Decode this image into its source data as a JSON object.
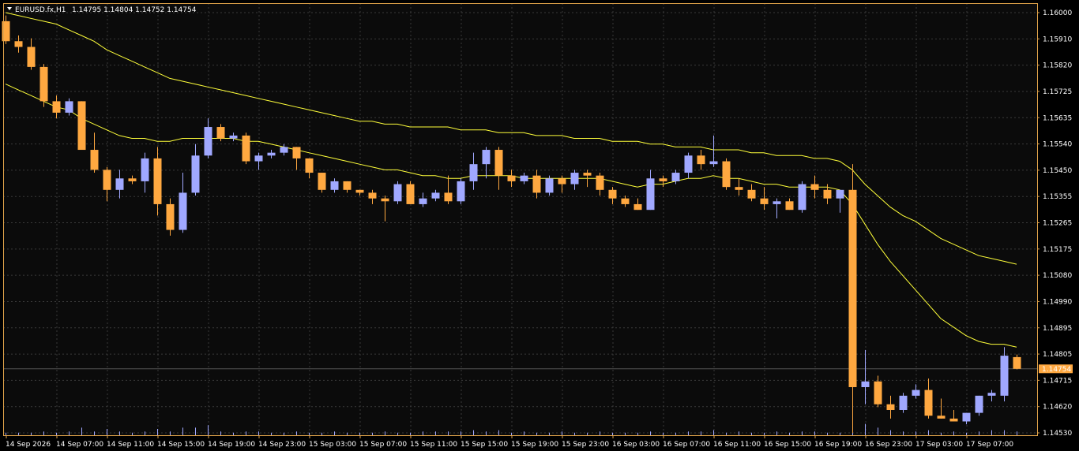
{
  "header": {
    "symbol_label": "EURUSD.fx,H1",
    "ohlc_text": "1.14795 1.14804 1.14752 1.14754"
  },
  "colors": {
    "background": "#000000",
    "plot_background": "#0b0b0b",
    "frame": "#e0a34a",
    "grid": "#3a3a3a",
    "bull": "#a0a8ff",
    "bear": "#ffa840",
    "ma": "#ffff3a",
    "text": "#ffffff",
    "price_tag_bg": "#ffa840",
    "volume": "#a0a8ff"
  },
  "chart_data": {
    "type": "candlestick",
    "symbol": "EURUSD.fx",
    "timeframe": "H1",
    "y_ticks": [
      "1.16000",
      "1.15910",
      "1.15820",
      "1.15725",
      "1.15635",
      "1.15540",
      "1.15450",
      "1.15355",
      "1.15265",
      "1.15175",
      "1.15080",
      "1.14990",
      "1.14895",
      "1.14805",
      "1.14715",
      "1.14620",
      "1.14530"
    ],
    "ylim": [
      1.1453,
      1.1605
    ],
    "current_price": 1.14754,
    "current_price_label": "1.14754",
    "x_ticks": [
      "14 Sep 2026",
      "14 Sep 07:00",
      "14 Sep 11:00",
      "14 Sep 15:00",
      "14 Sep 19:00",
      "14 Sep 23:00",
      "15 Sep 03:00",
      "15 Sep 07:00",
      "15 Sep 11:00",
      "15 Sep 15:00",
      "15 Sep 19:00",
      "15 Sep 23:00",
      "16 Sep 03:00",
      "16 Sep 07:00",
      "16 Sep 11:00",
      "16 Sep 15:00",
      "16 Sep 19:00",
      "16 Sep 23:00",
      "17 Sep 03:00",
      "17 Sep 07:00"
    ],
    "candles": [
      [
        1.1597,
        1.1599,
        1.1589,
        1.159
      ],
      [
        1.159,
        1.1592,
        1.1586,
        1.1588
      ],
      [
        1.1588,
        1.1591,
        1.158,
        1.1581
      ],
      [
        1.1581,
        1.1582,
        1.1567,
        1.1569
      ],
      [
        1.1569,
        1.1571,
        1.1563,
        1.1565
      ],
      [
        1.1565,
        1.157,
        1.1564,
        1.1569
      ],
      [
        1.1569,
        1.1569,
        1.1552,
        1.1552
      ],
      [
        1.1552,
        1.1558,
        1.1544,
        1.1545
      ],
      [
        1.1545,
        1.1546,
        1.1534,
        1.1538
      ],
      [
        1.1538,
        1.1545,
        1.1535,
        1.1542
      ],
      [
        1.1542,
        1.1543,
        1.154,
        1.1541
      ],
      [
        1.1541,
        1.1551,
        1.1537,
        1.1549
      ],
      [
        1.1549,
        1.1553,
        1.1529,
        1.1533
      ],
      [
        1.1533,
        1.1535,
        1.1522,
        1.1524
      ],
      [
        1.1524,
        1.1544,
        1.1523,
        1.1537
      ],
      [
        1.1537,
        1.1554,
        1.1536,
        1.155
      ],
      [
        1.155,
        1.1563,
        1.1549,
        1.156
      ],
      [
        1.156,
        1.1561,
        1.1555,
        1.1556
      ],
      [
        1.1556,
        1.1558,
        1.1555,
        1.1557
      ],
      [
        1.1557,
        1.1558,
        1.1547,
        1.1548
      ],
      [
        1.1548,
        1.1551,
        1.1545,
        1.155
      ],
      [
        1.155,
        1.1552,
        1.1549,
        1.1551
      ],
      [
        1.1551,
        1.1554,
        1.155,
        1.1553
      ],
      [
        1.1553,
        1.1553,
        1.1545,
        1.1549
      ],
      [
        1.1549,
        1.1549,
        1.1542,
        1.1544
      ],
      [
        1.1544,
        1.1544,
        1.1537,
        1.1538
      ],
      [
        1.1538,
        1.1542,
        1.1537,
        1.1541
      ],
      [
        1.1541,
        1.1541,
        1.1537,
        1.1538
      ],
      [
        1.1538,
        1.1538,
        1.1536,
        1.1537
      ],
      [
        1.1537,
        1.1538,
        1.1533,
        1.1535
      ],
      [
        1.1535,
        1.1536,
        1.1527,
        1.1534
      ],
      [
        1.1534,
        1.1541,
        1.1533,
        1.154
      ],
      [
        1.154,
        1.1541,
        1.1533,
        1.1533
      ],
      [
        1.1533,
        1.1537,
        1.1532,
        1.1535
      ],
      [
        1.1535,
        1.1538,
        1.1534,
        1.1537
      ],
      [
        1.1537,
        1.1543,
        1.1533,
        1.1534
      ],
      [
        1.1534,
        1.1542,
        1.1533,
        1.1541
      ],
      [
        1.1541,
        1.1551,
        1.1538,
        1.1547
      ],
      [
        1.1547,
        1.1553,
        1.1542,
        1.1552
      ],
      [
        1.1552,
        1.1553,
        1.1538,
        1.1543
      ],
      [
        1.1543,
        1.1545,
        1.1539,
        1.1541
      ],
      [
        1.1541,
        1.1544,
        1.154,
        1.1543
      ],
      [
        1.1543,
        1.1545,
        1.1535,
        1.1537
      ],
      [
        1.1537,
        1.1543,
        1.1536,
        1.1542
      ],
      [
        1.1542,
        1.1543,
        1.1537,
        1.154
      ],
      [
        1.154,
        1.1545,
        1.1538,
        1.1544
      ],
      [
        1.1544,
        1.1545,
        1.1539,
        1.1543
      ],
      [
        1.1543,
        1.1544,
        1.1536,
        1.1538
      ],
      [
        1.1538,
        1.1539,
        1.1533,
        1.1535
      ],
      [
        1.1535,
        1.1536,
        1.1532,
        1.1533
      ],
      [
        1.1533,
        1.1535,
        1.1531,
        1.1531
      ],
      [
        1.1531,
        1.1545,
        1.1531,
        1.1542
      ],
      [
        1.1542,
        1.1543,
        1.1539,
        1.1541
      ],
      [
        1.1541,
        1.1545,
        1.154,
        1.1544
      ],
      [
        1.1544,
        1.1551,
        1.1542,
        1.155
      ],
      [
        1.155,
        1.1552,
        1.1545,
        1.1547
      ],
      [
        1.1547,
        1.1557,
        1.1546,
        1.1548
      ],
      [
        1.1548,
        1.1549,
        1.1538,
        1.1539
      ],
      [
        1.1539,
        1.1542,
        1.1536,
        1.1538
      ],
      [
        1.1538,
        1.154,
        1.1534,
        1.1535
      ],
      [
        1.1535,
        1.1539,
        1.1531,
        1.1533
      ],
      [
        1.1533,
        1.1535,
        1.1528,
        1.1534
      ],
      [
        1.1534,
        1.1535,
        1.1531,
        1.1531
      ],
      [
        1.1531,
        1.1541,
        1.153,
        1.154
      ],
      [
        1.154,
        1.1543,
        1.1535,
        1.1538
      ],
      [
        1.1538,
        1.154,
        1.1533,
        1.1535
      ],
      [
        1.1535,
        1.1538,
        1.153,
        1.1538
      ],
      [
        1.1538,
        1.1547,
        1.1453,
        1.1469
      ],
      [
        1.1469,
        1.1482,
        1.1463,
        1.1471
      ],
      [
        1.1471,
        1.1473,
        1.1462,
        1.1463
      ],
      [
        1.1463,
        1.1466,
        1.1458,
        1.1461
      ],
      [
        1.1461,
        1.1467,
        1.146,
        1.1466
      ],
      [
        1.1466,
        1.147,
        1.1465,
        1.1468
      ],
      [
        1.1468,
        1.1472,
        1.1458,
        1.1459
      ],
      [
        1.1459,
        1.1465,
        1.1458,
        1.1458
      ],
      [
        1.1458,
        1.1461,
        1.1457,
        1.1457
      ],
      [
        1.1457,
        1.146,
        1.1456,
        1.146
      ],
      [
        1.146,
        1.1466,
        1.1459,
        1.1466
      ],
      [
        1.1466,
        1.1468,
        1.1464,
        1.1467
      ],
      [
        1.1466,
        1.1483,
        1.1464,
        1.148
      ],
      [
        1.14795,
        1.14804,
        1.14752,
        1.14754
      ]
    ],
    "moving_averages": [
      {
        "name": "",
        "values": [
          1.16,
          1.1599,
          1.1598,
          1.1597,
          1.1596,
          1.1594,
          1.1592,
          1.159,
          1.1587,
          1.1585,
          1.1583,
          1.1581,
          1.1579,
          1.1577,
          1.1576,
          1.1575,
          1.1574,
          1.1573,
          1.1572,
          1.1571,
          1.157,
          1.1569,
          1.1568,
          1.1567,
          1.1566,
          1.1565,
          1.1564,
          1.1563,
          1.1562,
          1.1562,
          1.1561,
          1.1561,
          1.156,
          1.156,
          1.156,
          1.156,
          1.1559,
          1.1559,
          1.1559,
          1.1558,
          1.1558,
          1.1558,
          1.1557,
          1.1557,
          1.1557,
          1.1556,
          1.1556,
          1.1556,
          1.1555,
          1.1555,
          1.1555,
          1.1554,
          1.1554,
          1.1553,
          1.1553,
          1.1553,
          1.1552,
          1.1552,
          1.1552,
          1.1551,
          1.1551,
          1.155,
          1.155,
          1.155,
          1.1549,
          1.1549,
          1.1548,
          1.1545,
          1.154,
          1.1536,
          1.1532,
          1.1529,
          1.1527,
          1.1524,
          1.1521,
          1.1519,
          1.1517,
          1.1515,
          1.1514,
          1.1513,
          1.1512
        ]
      },
      {
        "name": "",
        "values": [
          1.1575,
          1.1573,
          1.1571,
          1.1569,
          1.1567,
          1.1566,
          1.1563,
          1.1561,
          1.1559,
          1.1557,
          1.1556,
          1.1556,
          1.1555,
          1.1555,
          1.1556,
          1.1556,
          1.1556,
          1.1556,
          1.1556,
          1.1555,
          1.1555,
          1.1554,
          1.1553,
          1.1552,
          1.1551,
          1.155,
          1.1549,
          1.1548,
          1.1547,
          1.1546,
          1.1545,
          1.1545,
          1.1544,
          1.1543,
          1.1543,
          1.1542,
          1.1542,
          1.1543,
          1.1543,
          1.1543,
          1.1543,
          1.1542,
          1.1542,
          1.1542,
          1.1542,
          1.1542,
          1.1542,
          1.1542,
          1.1541,
          1.154,
          1.1539,
          1.154,
          1.154,
          1.1541,
          1.1542,
          1.1542,
          1.1543,
          1.1542,
          1.1542,
          1.1541,
          1.154,
          1.154,
          1.1539,
          1.1539,
          1.1539,
          1.1539,
          1.1538,
          1.1533,
          1.1526,
          1.1519,
          1.1513,
          1.1508,
          1.1503,
          1.1498,
          1.1493,
          1.149,
          1.1487,
          1.1485,
          1.1484,
          1.1484,
          1.1483
        ]
      }
    ],
    "volume": [
      2,
      2,
      2,
      3,
      2,
      3,
      6,
      3,
      5,
      3,
      2,
      3,
      5,
      3,
      6,
      6,
      8,
      3,
      2,
      3,
      3,
      2,
      2,
      3,
      2,
      2,
      3,
      2,
      2,
      2,
      3,
      2,
      2,
      3,
      3,
      3,
      3,
      4,
      3,
      4,
      2,
      3,
      2,
      2,
      3,
      2,
      2,
      3,
      2,
      2,
      2,
      3,
      2,
      2,
      3,
      3,
      4,
      2,
      3,
      2,
      2,
      3,
      2,
      3,
      3,
      2,
      2,
      12,
      9,
      6,
      4,
      3,
      3,
      4,
      2,
      3,
      2,
      3,
      4,
      4,
      3
    ]
  }
}
